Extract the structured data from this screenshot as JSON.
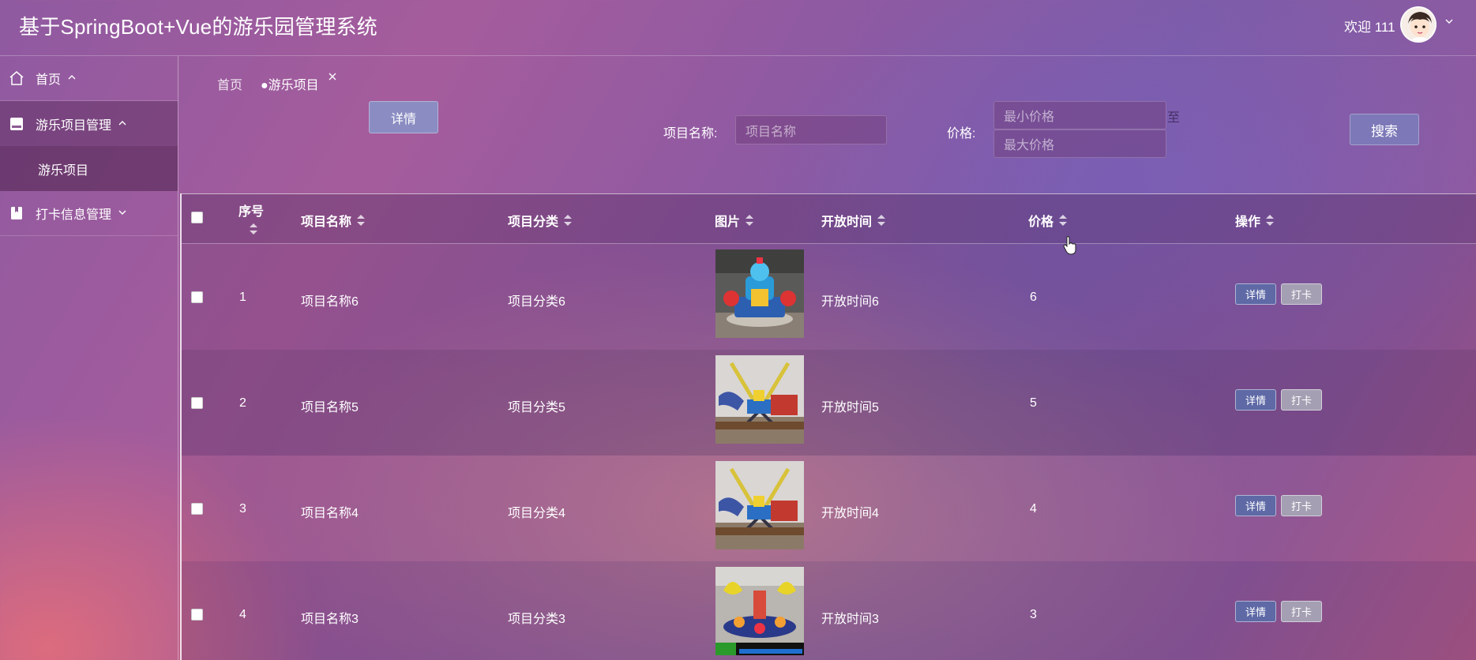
{
  "header": {
    "app_title": "基于SpringBoot+Vue的游乐园管理系统",
    "welcome": "欢迎 111"
  },
  "sidebar": {
    "items": [
      {
        "label": "首页",
        "icon": "home-icon",
        "chevron": "^"
      },
      {
        "label": "游乐项目管理",
        "icon": "folder-icon",
        "chevron": "^",
        "children": [
          {
            "label": "游乐项目"
          }
        ]
      },
      {
        "label": "打卡信息管理",
        "icon": "bookmark-icon",
        "chevron": "v"
      }
    ]
  },
  "tabs": [
    {
      "label": "首页"
    },
    {
      "label": "●游乐项目"
    }
  ],
  "toolbar": {
    "detail_label": "详情",
    "name_label": "项目名称:",
    "name_placeholder": "项目名称",
    "price_label": "价格:",
    "min_price_placeholder": "最小价格",
    "max_price_placeholder": "最大价格",
    "to_text": "至",
    "search_label": "搜索"
  },
  "table": {
    "columns": [
      "序号",
      "项目名称",
      "项目分类",
      "图片",
      "开放时间",
      "价格",
      "操作"
    ],
    "rows": [
      {
        "index": "1",
        "name": "项目名称6",
        "category": "项目分类6",
        "open_time": "开放时间6",
        "price": "6"
      },
      {
        "index": "2",
        "name": "项目名称5",
        "category": "项目分类5",
        "open_time": "开放时间5",
        "price": "5"
      },
      {
        "index": "3",
        "name": "项目名称4",
        "category": "项目分类4",
        "open_time": "开放时间4",
        "price": "4"
      },
      {
        "index": "4",
        "name": "项目名称3",
        "category": "项目分类3",
        "open_time": "开放时间3",
        "price": "3"
      }
    ],
    "action_detail": "详情",
    "action_checkin": "打卡"
  }
}
